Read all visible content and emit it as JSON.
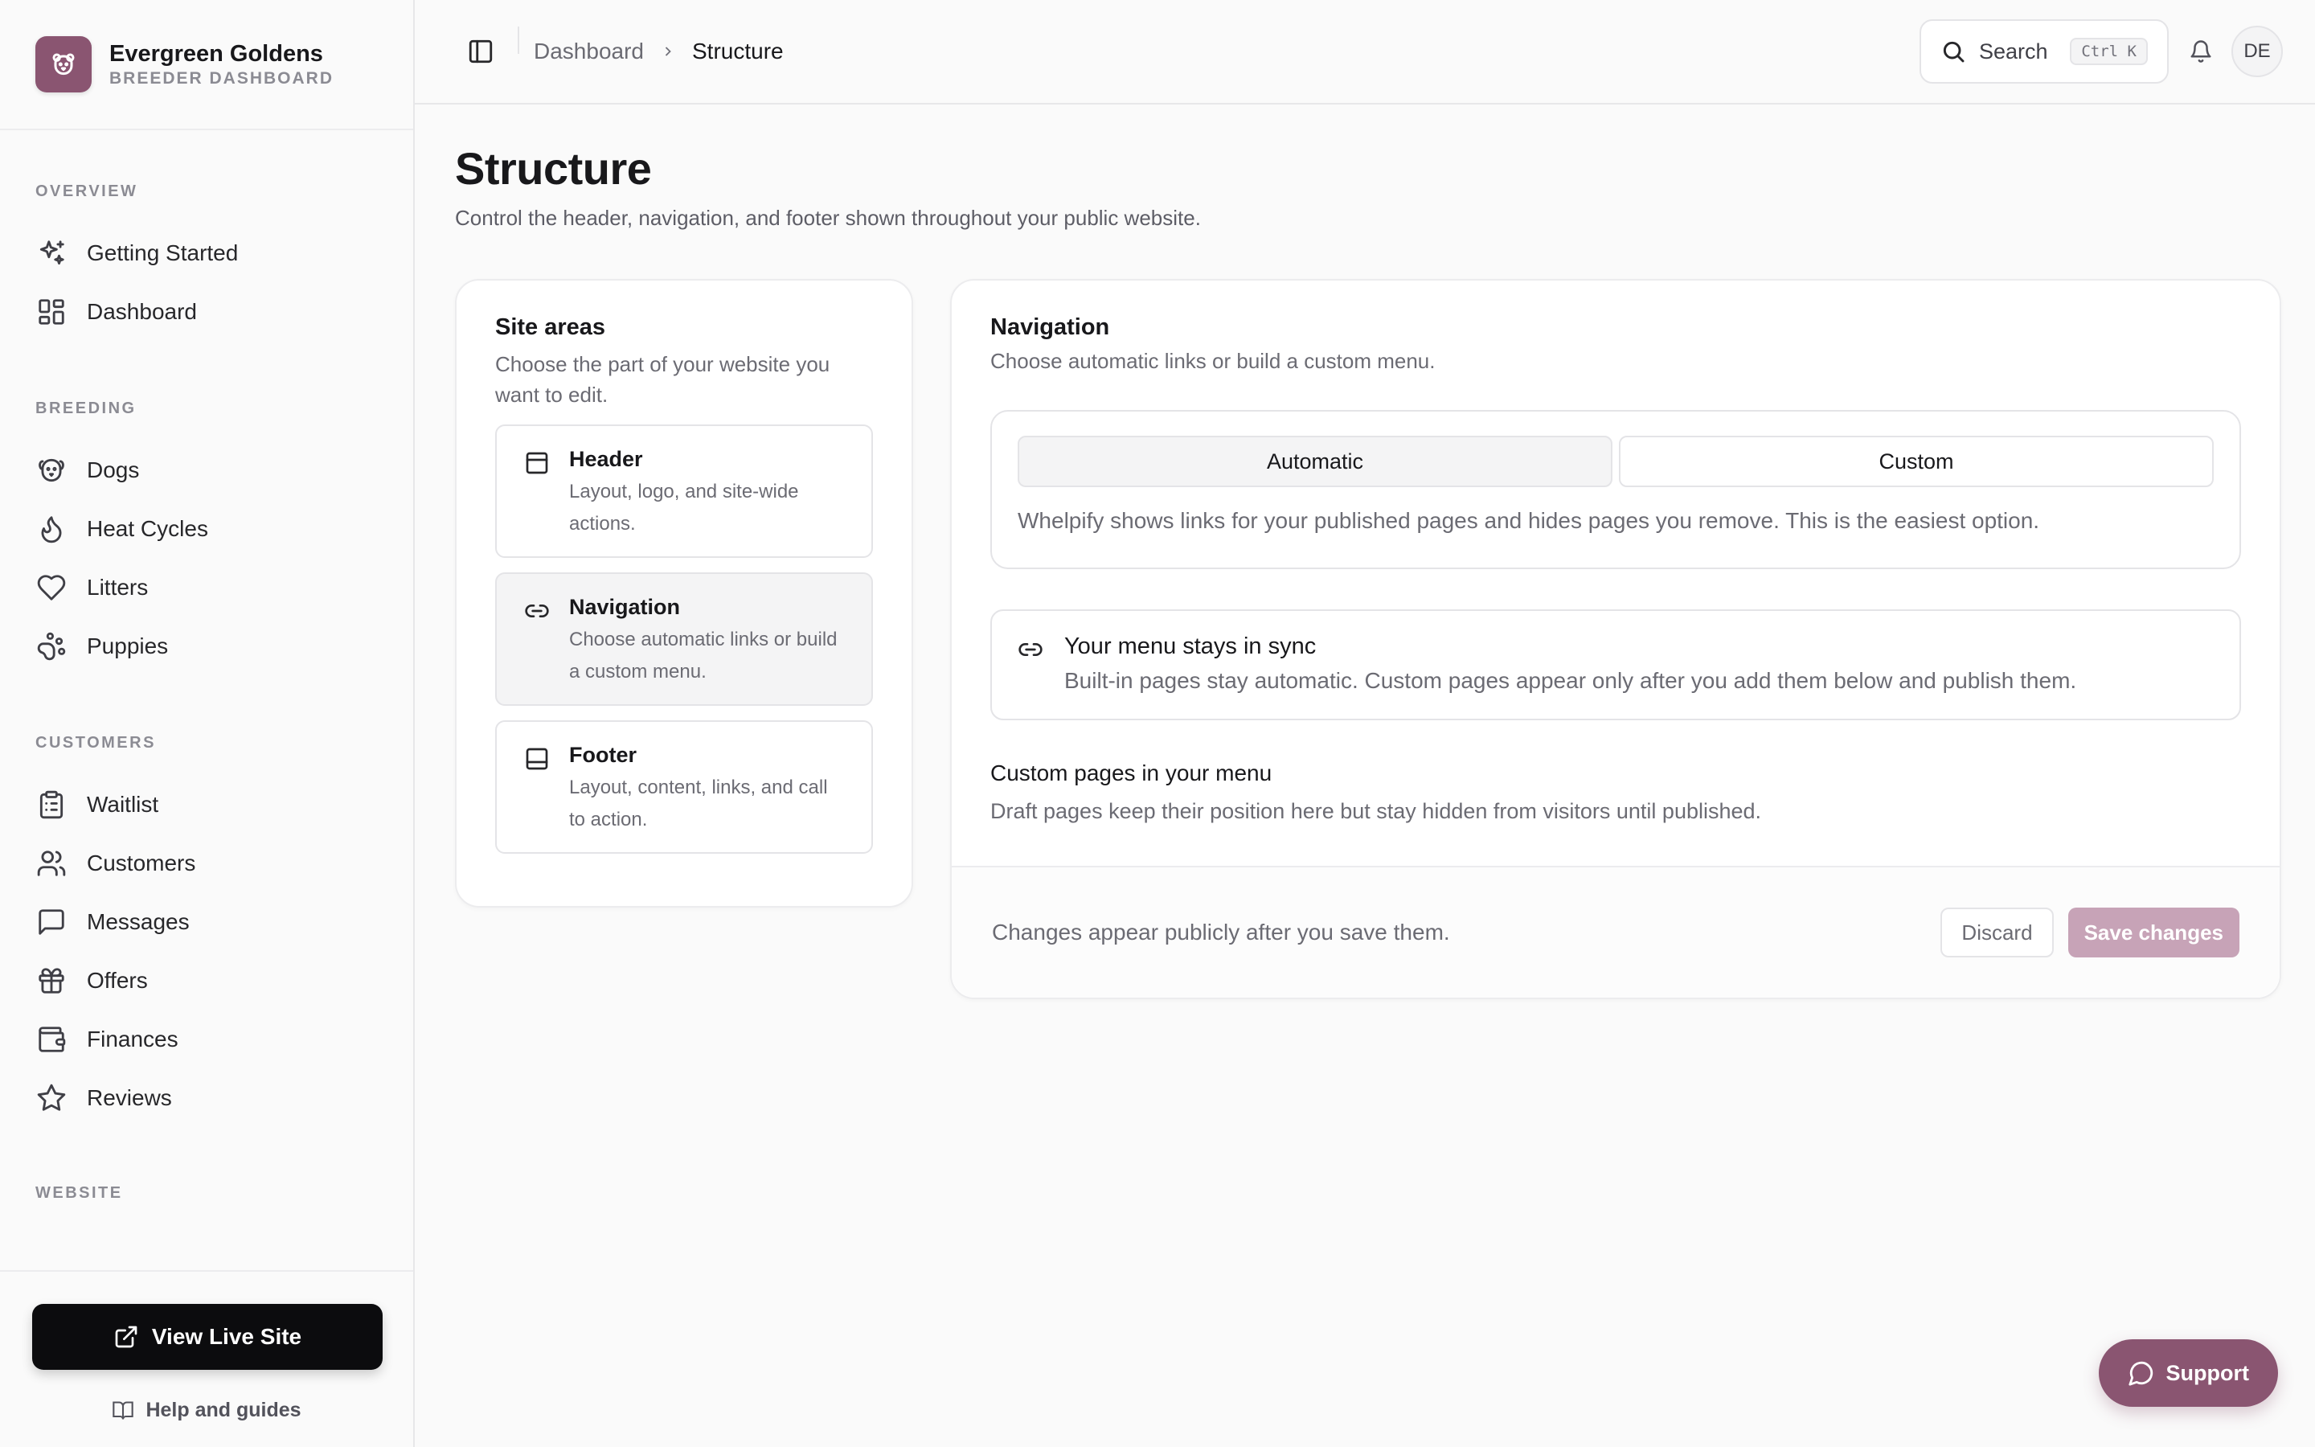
{
  "brand": {
    "name": "Evergreen Goldens",
    "subtitle": "BREEDER DASHBOARD",
    "logo_icon": "paw-bear-icon",
    "accent": "#8a5571"
  },
  "sidebar": {
    "sections": [
      {
        "label": "OVERVIEW",
        "items": [
          {
            "label": "Getting Started",
            "icon": "sparkles-icon"
          },
          {
            "label": "Dashboard",
            "icon": "layout-grid-icon"
          }
        ]
      },
      {
        "label": "BREEDING",
        "items": [
          {
            "label": "Dogs",
            "icon": "dog-icon"
          },
          {
            "label": "Heat Cycles",
            "icon": "flame-icon"
          },
          {
            "label": "Litters",
            "icon": "heart-icon"
          },
          {
            "label": "Puppies",
            "icon": "paw-icon"
          }
        ]
      },
      {
        "label": "CUSTOMERS",
        "items": [
          {
            "label": "Waitlist",
            "icon": "clipboard-list-icon"
          },
          {
            "label": "Customers",
            "icon": "users-icon"
          },
          {
            "label": "Messages",
            "icon": "message-square-icon"
          },
          {
            "label": "Offers",
            "icon": "gift-icon"
          },
          {
            "label": "Finances",
            "icon": "wallet-icon"
          },
          {
            "label": "Reviews",
            "icon": "star-icon"
          }
        ]
      },
      {
        "label": "WEBSITE",
        "items": []
      }
    ],
    "live_site_label": "View Live Site",
    "help_label": "Help and guides"
  },
  "topbar": {
    "breadcrumb": [
      "Dashboard",
      "Structure"
    ],
    "search_label": "Search",
    "search_shortcut": "Ctrl K",
    "avatar_initials": "DE"
  },
  "page": {
    "title": "Structure",
    "subtitle": "Control the header, navigation, and footer shown throughout your public website."
  },
  "site_areas": {
    "title": "Site areas",
    "description": "Choose the part of your website you want to edit.",
    "items": [
      {
        "title": "Header",
        "description": "Layout, logo, and site-wide actions.",
        "icon": "panel-top-icon",
        "active": false
      },
      {
        "title": "Navigation",
        "description": "Choose automatic links or build a custom menu.",
        "icon": "link-icon",
        "active": true
      },
      {
        "title": "Footer",
        "description": "Layout, content, links, and call to action.",
        "icon": "panel-bottom-icon",
        "active": false
      }
    ]
  },
  "navigation": {
    "title": "Navigation",
    "description": "Choose automatic links or build a custom menu.",
    "modes": [
      {
        "label": "Automatic",
        "selected": true
      },
      {
        "label": "Custom",
        "selected": false
      }
    ],
    "mode_description": "Whelpify shows links for your published pages and hides pages you remove. This is the easiest option.",
    "sync_notice": {
      "title": "Your menu stays in sync",
      "description": "Built-in pages stay automatic. Custom pages appear only after you add them below and publish them.",
      "icon": "link-icon"
    },
    "custom_pages": {
      "title": "Custom pages in your menu",
      "description": "Draft pages keep their position here but stay hidden from visitors until published."
    },
    "footer_note": "Changes appear publicly after you save them.",
    "discard_label": "Discard",
    "save_label": "Save changes"
  },
  "support": {
    "label": "Support"
  }
}
